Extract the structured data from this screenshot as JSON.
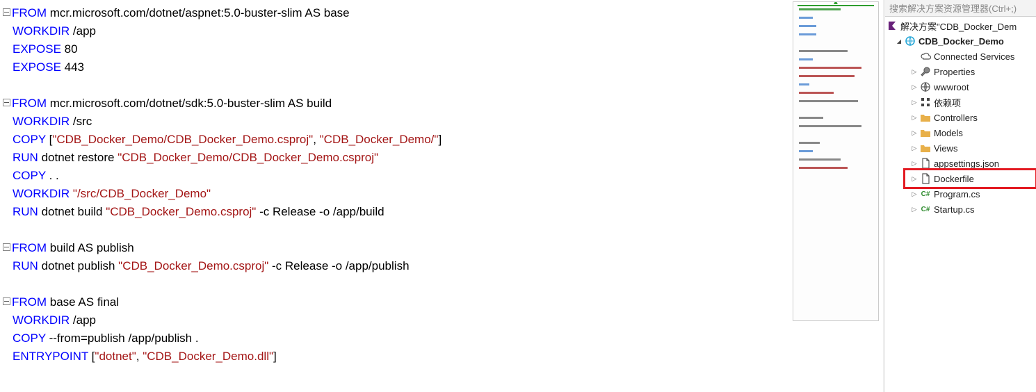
{
  "code": {
    "lines": [
      {
        "fold": true,
        "indent": 0,
        "tokens": [
          {
            "c": "kw",
            "t": "FROM"
          },
          {
            "c": "txt",
            "t": " mcr.microsoft.com/dotnet/aspnet:5.0-buster-slim AS base"
          }
        ]
      },
      {
        "fold": false,
        "indent": 1,
        "tokens": [
          {
            "c": "kw",
            "t": "WORKDIR"
          },
          {
            "c": "txt",
            "t": " /app"
          }
        ]
      },
      {
        "fold": false,
        "indent": 1,
        "tokens": [
          {
            "c": "kw",
            "t": "EXPOSE"
          },
          {
            "c": "txt",
            "t": " 80"
          }
        ]
      },
      {
        "fold": false,
        "indent": 1,
        "tokens": [
          {
            "c": "kw",
            "t": "EXPOSE"
          },
          {
            "c": "txt",
            "t": " 443"
          }
        ]
      },
      {
        "blank": true
      },
      {
        "fold": true,
        "indent": 0,
        "tokens": [
          {
            "c": "kw",
            "t": "FROM"
          },
          {
            "c": "txt",
            "t": " mcr.microsoft.com/dotnet/sdk:5.0-buster-slim AS build"
          }
        ]
      },
      {
        "fold": false,
        "indent": 1,
        "tokens": [
          {
            "c": "kw",
            "t": "WORKDIR"
          },
          {
            "c": "txt",
            "t": " /src"
          }
        ]
      },
      {
        "fold": false,
        "indent": 1,
        "tokens": [
          {
            "c": "kw",
            "t": "COPY"
          },
          {
            "c": "txt",
            "t": " ["
          },
          {
            "c": "str",
            "t": "\"CDB_Docker_Demo/CDB_Docker_Demo.csproj\""
          },
          {
            "c": "txt",
            "t": ", "
          },
          {
            "c": "str",
            "t": "\"CDB_Docker_Demo/\""
          },
          {
            "c": "txt",
            "t": "]"
          }
        ]
      },
      {
        "fold": false,
        "indent": 1,
        "tokens": [
          {
            "c": "kw",
            "t": "RUN"
          },
          {
            "c": "txt",
            "t": " dotnet restore "
          },
          {
            "c": "str",
            "t": "\"CDB_Docker_Demo/CDB_Docker_Demo.csproj\""
          }
        ]
      },
      {
        "fold": false,
        "indent": 1,
        "tokens": [
          {
            "c": "kw",
            "t": "COPY"
          },
          {
            "c": "txt",
            "t": " . ."
          }
        ]
      },
      {
        "fold": false,
        "indent": 1,
        "tokens": [
          {
            "c": "kw",
            "t": "WORKDIR"
          },
          {
            "c": "txt",
            "t": " "
          },
          {
            "c": "str",
            "t": "\"/src/CDB_Docker_Demo\""
          }
        ]
      },
      {
        "fold": false,
        "indent": 1,
        "tokens": [
          {
            "c": "kw",
            "t": "RUN"
          },
          {
            "c": "txt",
            "t": " dotnet build "
          },
          {
            "c": "str",
            "t": "\"CDB_Docker_Demo.csproj\""
          },
          {
            "c": "txt",
            "t": " -c Release -o /app/build"
          }
        ]
      },
      {
        "blank": true
      },
      {
        "fold": true,
        "indent": 0,
        "tokens": [
          {
            "c": "kw",
            "t": "FROM"
          },
          {
            "c": "txt",
            "t": " build AS publish"
          }
        ]
      },
      {
        "fold": false,
        "indent": 1,
        "tokens": [
          {
            "c": "kw",
            "t": "RUN"
          },
          {
            "c": "txt",
            "t": " dotnet publish "
          },
          {
            "c": "str",
            "t": "\"CDB_Docker_Demo.csproj\""
          },
          {
            "c": "txt",
            "t": " -c Release -o /app/publish"
          }
        ]
      },
      {
        "blank": true
      },
      {
        "fold": true,
        "indent": 0,
        "tokens": [
          {
            "c": "kw",
            "t": "FROM"
          },
          {
            "c": "txt",
            "t": " base AS final"
          }
        ]
      },
      {
        "fold": false,
        "indent": 1,
        "tokens": [
          {
            "c": "kw",
            "t": "WORKDIR"
          },
          {
            "c": "txt",
            "t": " /app"
          }
        ]
      },
      {
        "fold": false,
        "indent": 1,
        "tokens": [
          {
            "c": "kw",
            "t": "COPY"
          },
          {
            "c": "txt",
            "t": " --from=publish /app/publish ."
          }
        ]
      },
      {
        "fold": false,
        "indent": 1,
        "tokens": [
          {
            "c": "kw",
            "t": "ENTRYPOINT"
          },
          {
            "c": "txt",
            "t": " ["
          },
          {
            "c": "str",
            "t": "\"dotnet\""
          },
          {
            "c": "txt",
            "t": ", "
          },
          {
            "c": "str",
            "t": "\"CDB_Docker_Demo.dll\""
          },
          {
            "c": "txt",
            "t": "]"
          }
        ]
      }
    ]
  },
  "solution_explorer": {
    "search_placeholder": "搜索解决方案资源管理器(Ctrl+;)",
    "solution_label": "解决方案\"CDB_Docker_Dem",
    "project": {
      "name": "CDB_Docker_Demo",
      "items": [
        {
          "icon": "cloud",
          "label": "Connected Services",
          "exp": "none",
          "indent": 2
        },
        {
          "icon": "wrench",
          "label": "Properties",
          "exp": "closed",
          "indent": 2
        },
        {
          "icon": "globe",
          "label": "wwwroot",
          "exp": "closed",
          "indent": 2
        },
        {
          "icon": "dep",
          "label": "依赖项",
          "exp": "closed",
          "indent": 2
        },
        {
          "icon": "folder",
          "label": "Controllers",
          "exp": "closed",
          "indent": 2
        },
        {
          "icon": "folder",
          "label": "Models",
          "exp": "closed",
          "indent": 2
        },
        {
          "icon": "folder",
          "label": "Views",
          "exp": "closed",
          "indent": 2
        },
        {
          "icon": "file",
          "label": "appsettings.json",
          "exp": "closed",
          "indent": 2
        },
        {
          "icon": "file",
          "label": "Dockerfile",
          "exp": "closed",
          "indent": 2,
          "highlight": true
        },
        {
          "icon": "cs",
          "label": "Program.cs",
          "exp": "closed",
          "indent": 2
        },
        {
          "icon": "cs",
          "label": "Startup.cs",
          "exp": "closed",
          "indent": 2
        }
      ]
    }
  }
}
